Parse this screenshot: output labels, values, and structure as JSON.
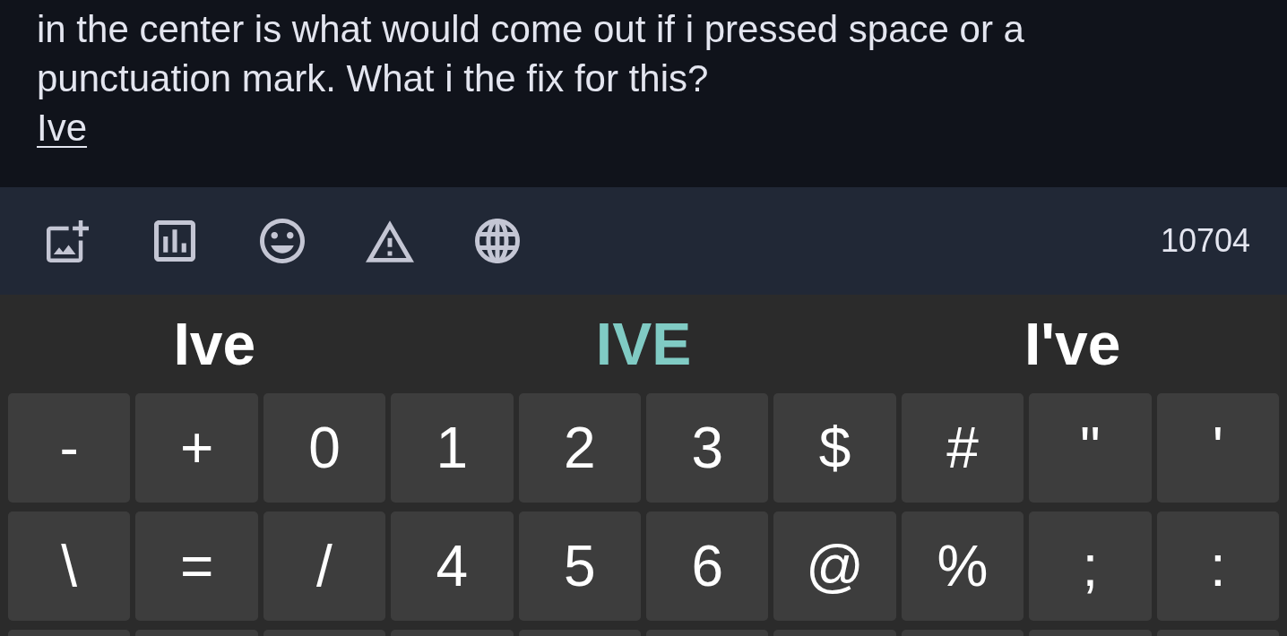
{
  "compose": {
    "text": "in the center is what would come out if i pressed space or a\npunctuation mark. What i the fix for this?",
    "composing_word": "Ive"
  },
  "toolbar": {
    "buttons": [
      {
        "kind": "image"
      },
      {
        "kind": "poll"
      },
      {
        "kind": "emoji"
      },
      {
        "kind": "warning"
      },
      {
        "kind": "language"
      }
    ],
    "counter": "10704"
  },
  "suggestions": [
    {
      "text": "Ive",
      "selected": false
    },
    {
      "text": "IVE",
      "selected": true
    },
    {
      "text": "I've",
      "selected": false
    }
  ],
  "keyboard": {
    "rows": [
      [
        "-",
        "+",
        "0",
        "1",
        "2",
        "3",
        "$",
        "#",
        "\"",
        "'"
      ],
      [
        "\\",
        "=",
        "/",
        "4",
        "5",
        "6",
        "@",
        "%",
        ";",
        ":"
      ]
    ]
  }
}
